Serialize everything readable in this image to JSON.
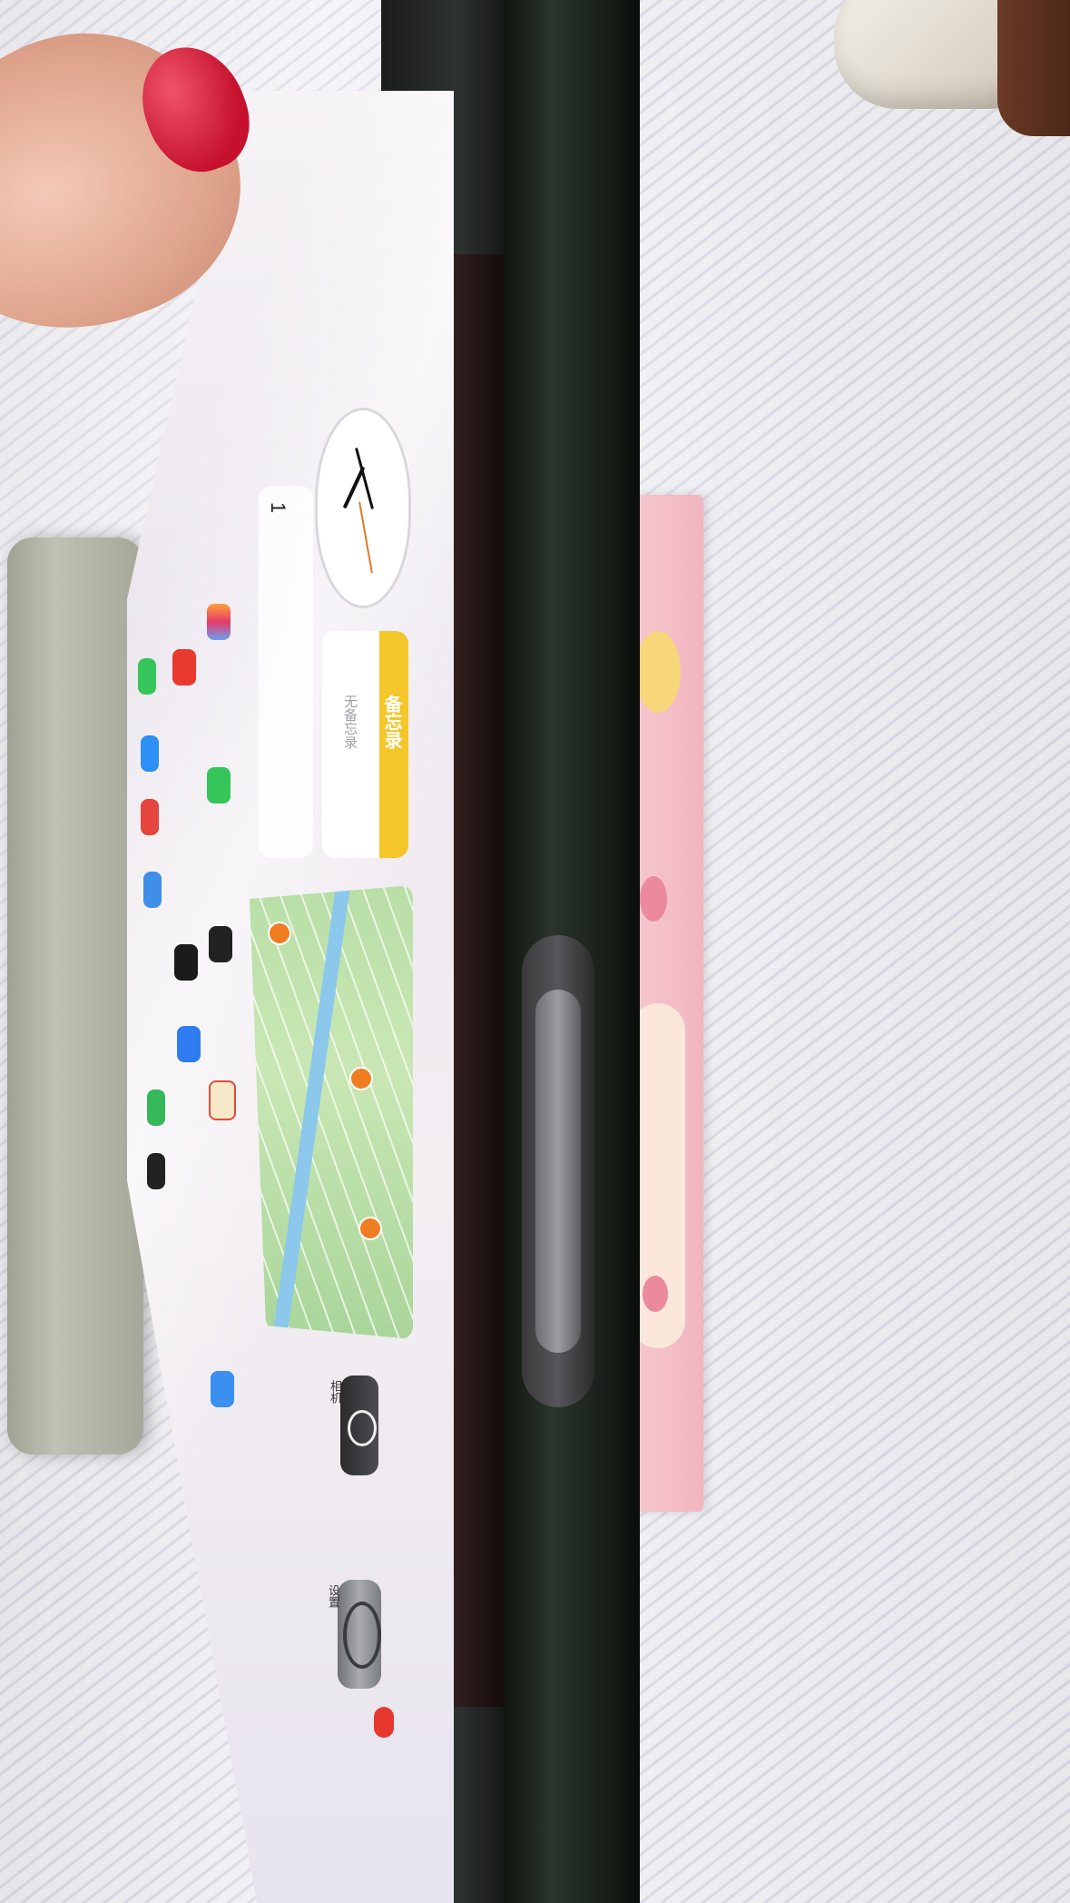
{
  "widgets": {
    "notes": {
      "title": "备忘录",
      "empty_text": "无备忘录"
    },
    "calendar": {
      "day": "1"
    }
  },
  "apps": [
    {
      "label": "相机"
    },
    {
      "label": "设置"
    }
  ],
  "colors": {
    "case_flap": "#a5a798",
    "tablet_frame": "#1f2820",
    "notes_yellow": "#f4c62a",
    "nail_polish": "#c5112e",
    "pink_box": "#f2b5bf"
  }
}
